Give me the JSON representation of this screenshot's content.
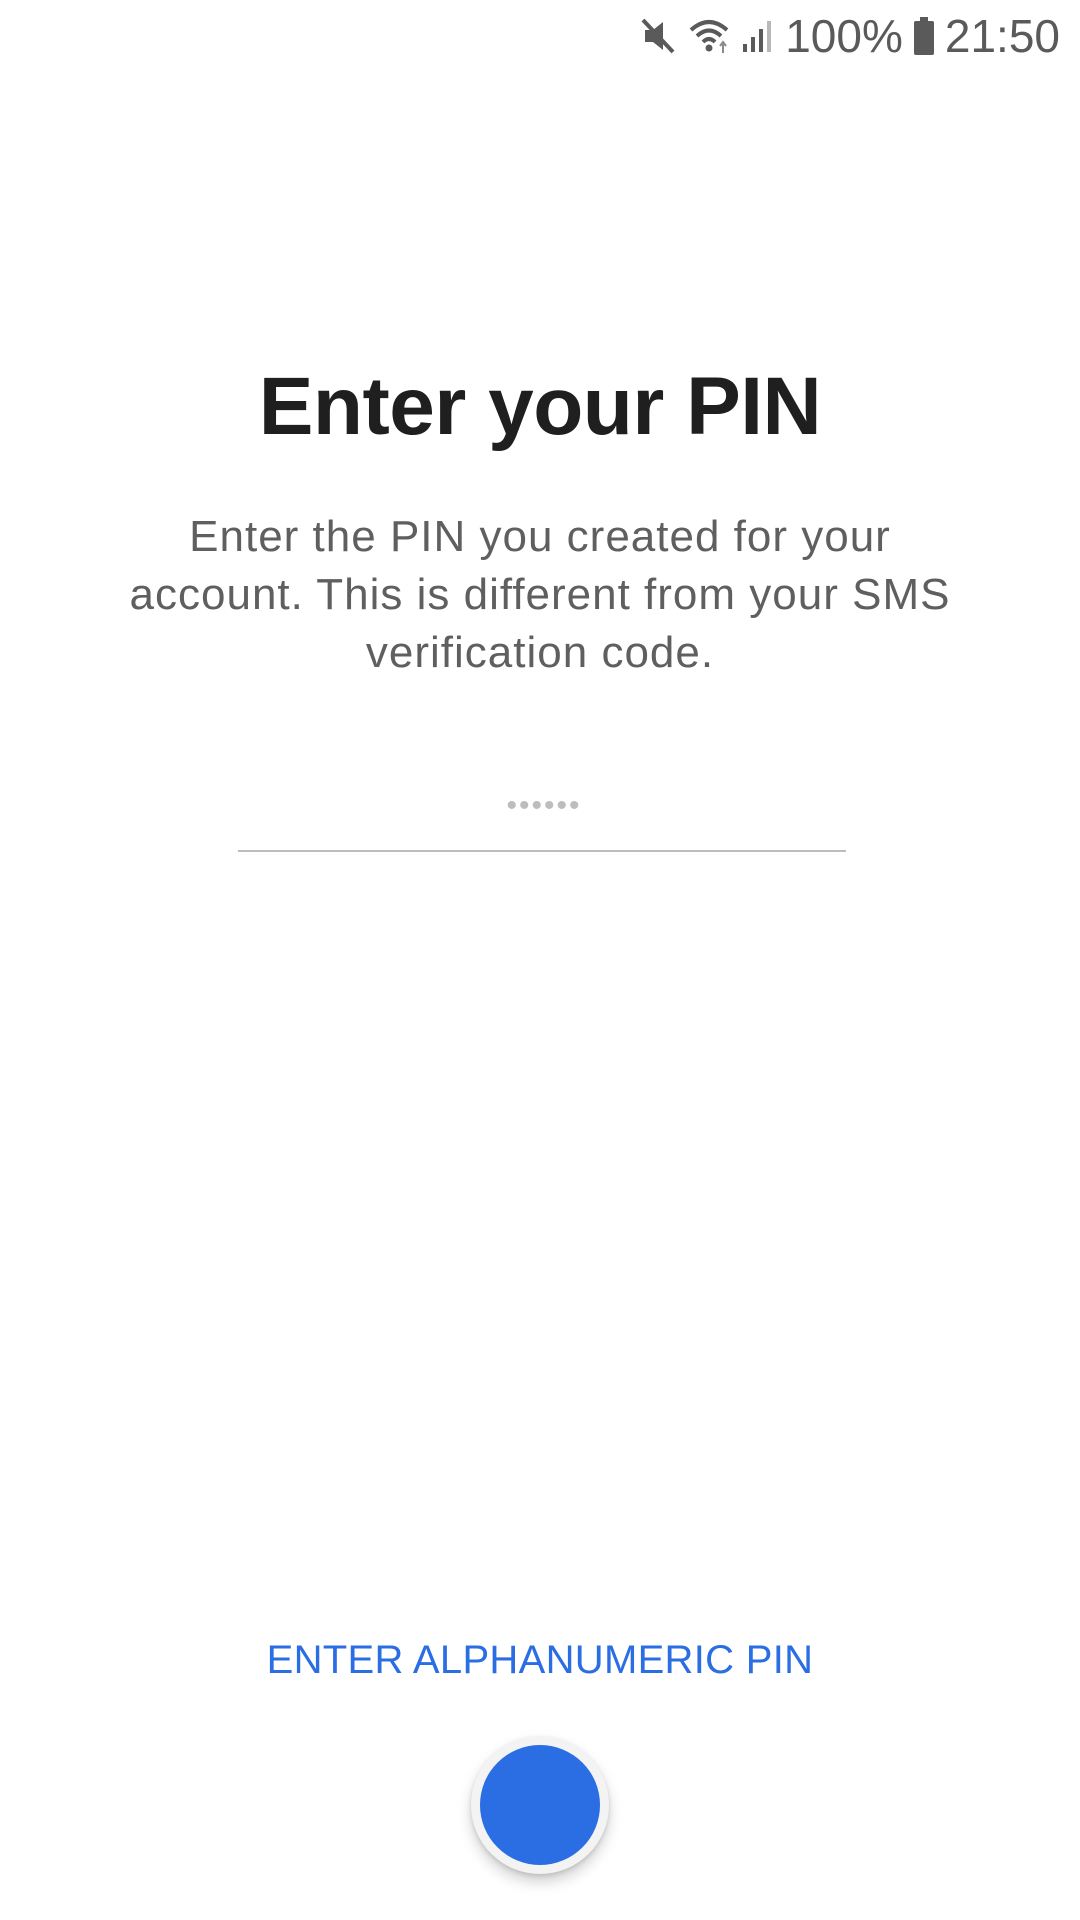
{
  "status_bar": {
    "battery_percent": "100%",
    "time": "21:50",
    "icons": [
      "mute-icon",
      "wifi-icon",
      "signal-icon",
      "battery-icon"
    ]
  },
  "screen": {
    "title": "Enter your PIN",
    "subtitle": "Enter the PIN you created for your account. This is different from your SMS verification code.",
    "pin_placeholder": "••••••",
    "alternate_action_label": "ENTER ALPHANUMERIC PIN"
  },
  "colors": {
    "accent": "#2b6de3",
    "title_text": "#1f1f1f",
    "subtitle_text": "#5f5f5f",
    "underline": "#bdbdbd"
  }
}
